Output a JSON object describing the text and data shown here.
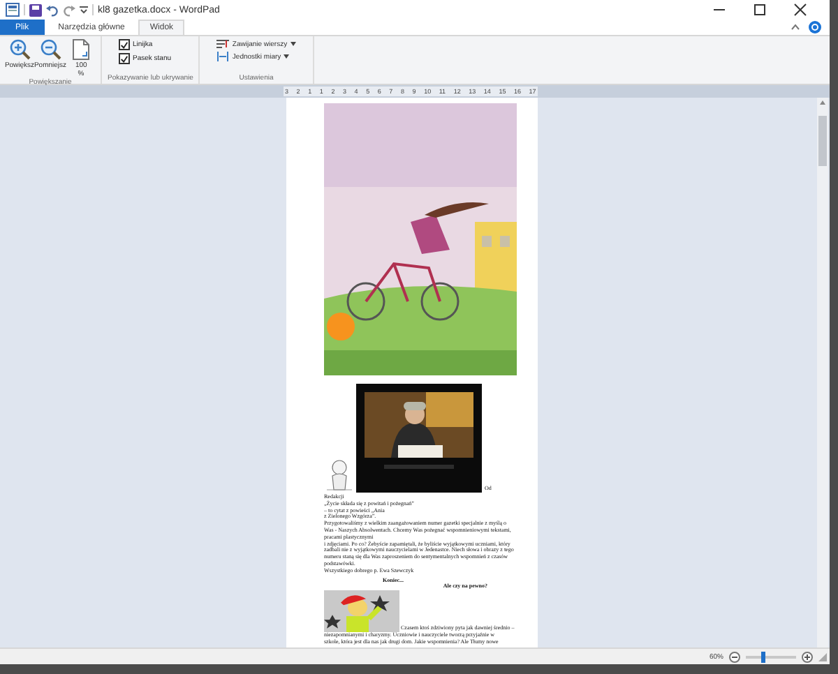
{
  "window": {
    "title": "kl8 gazetka.docx - WordPad"
  },
  "ribbon_tabs": [
    {
      "label": "Plik",
      "kind": "file",
      "selected": false
    },
    {
      "label": "Narzędzia główne",
      "kind": "tab",
      "selected": false
    },
    {
      "label": "Widok",
      "kind": "tab",
      "selected": true
    }
  ],
  "ribbon_groups": [
    {
      "label": "Powiększanie",
      "controls": [
        {
          "kind": "zoom_in",
          "label": "Powiększ"
        },
        {
          "kind": "zoom_out",
          "label": "Pomniejsz"
        },
        {
          "kind": "page",
          "label": "100 %"
        }
      ]
    },
    {
      "label": "Pokazywanie lub ukrywanie",
      "controls": [
        {
          "kind": "checkbox",
          "label": "Linijka",
          "checked": true
        },
        {
          "kind": "checkbox",
          "label": "Pasek stanu",
          "checked": true
        }
      ]
    },
    {
      "label": "Ustawienia",
      "controls": [
        {
          "kind": "wrap",
          "label": "Zawijanie wierszy"
        },
        {
          "kind": "units",
          "label": "Jednostki miary"
        }
      ]
    }
  ],
  "ruler": {
    "ticks": [
      "3",
      "2",
      "1",
      "1",
      "2",
      "3",
      "4",
      "5",
      "6",
      "7",
      "8",
      "9",
      "10",
      "11",
      "12",
      "13",
      "14",
      "15",
      "16",
      "17"
    ]
  },
  "document": {
    "side_text": "Od",
    "lines": [
      "Redakcji",
      "„Życie składa się z powitań i pożegnań”",
      "– to cytat z powieści „Ania",
      "z Zielonego Wzgórza”.",
      "Przygotowaliśmy z wielkim zaangażowaniem numer gazetki specjalnie z myślą o",
      "Was - Naszych Absolwentach. Chcemy Was pożegnać wspomnieniowymi tekstami,",
      "pracami plastycznymi",
      "i zdjęciami. Po co? Żebyście zapamiętali, że byliście wyjątkowymi uczniami, który",
      "zadbali nie z wyjątkowymi nauczycielami w Jedenastce. Niech słowa i obrazy z tego",
      "numeru staną się dla Was zaproszeniem do sentymentalnych wspomnień z czasów",
      "podstawówki.",
      "Wszystkiego dobrego          p. Ewa Szewczyk"
    ],
    "heading": "Koniec...",
    "subheading": "Ale czy na pewno?",
    "wrap_lines": [
      "Czasem ktoś zdziwiony pyta jak dawniej średnio –",
      "niezapomnianymi i charyzmy. Uczniowie i nauczyciele tworzą przyjaźnie w",
      "szkole, która jest dla nas jak drugi dom. Jakie wspomnienia? Ale Tłumy nowe"
    ]
  },
  "status_bar": {
    "zoom": "60%",
    "level": 0.33
  }
}
